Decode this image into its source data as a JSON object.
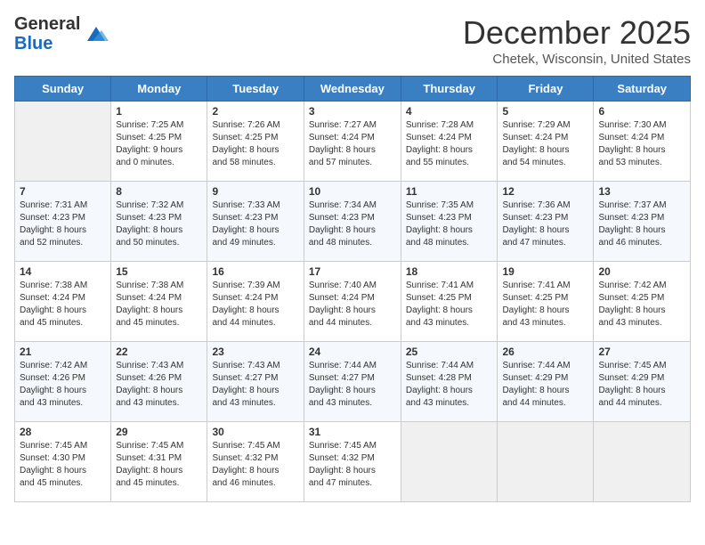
{
  "header": {
    "logo_general": "General",
    "logo_blue": "Blue",
    "month_title": "December 2025",
    "location": "Chetek, Wisconsin, United States"
  },
  "days_of_week": [
    "Sunday",
    "Monday",
    "Tuesday",
    "Wednesday",
    "Thursday",
    "Friday",
    "Saturday"
  ],
  "weeks": [
    [
      {
        "day": "",
        "sunrise": "",
        "sunset": "",
        "daylight": ""
      },
      {
        "day": "1",
        "sunrise": "Sunrise: 7:25 AM",
        "sunset": "Sunset: 4:25 PM",
        "daylight": "Daylight: 9 hours and 0 minutes."
      },
      {
        "day": "2",
        "sunrise": "Sunrise: 7:26 AM",
        "sunset": "Sunset: 4:25 PM",
        "daylight": "Daylight: 8 hours and 58 minutes."
      },
      {
        "day": "3",
        "sunrise": "Sunrise: 7:27 AM",
        "sunset": "Sunset: 4:24 PM",
        "daylight": "Daylight: 8 hours and 57 minutes."
      },
      {
        "day": "4",
        "sunrise": "Sunrise: 7:28 AM",
        "sunset": "Sunset: 4:24 PM",
        "daylight": "Daylight: 8 hours and 55 minutes."
      },
      {
        "day": "5",
        "sunrise": "Sunrise: 7:29 AM",
        "sunset": "Sunset: 4:24 PM",
        "daylight": "Daylight: 8 hours and 54 minutes."
      },
      {
        "day": "6",
        "sunrise": "Sunrise: 7:30 AM",
        "sunset": "Sunset: 4:24 PM",
        "daylight": "Daylight: 8 hours and 53 minutes."
      }
    ],
    [
      {
        "day": "7",
        "sunrise": "Sunrise: 7:31 AM",
        "sunset": "Sunset: 4:23 PM",
        "daylight": "Daylight: 8 hours and 52 minutes."
      },
      {
        "day": "8",
        "sunrise": "Sunrise: 7:32 AM",
        "sunset": "Sunset: 4:23 PM",
        "daylight": "Daylight: 8 hours and 50 minutes."
      },
      {
        "day": "9",
        "sunrise": "Sunrise: 7:33 AM",
        "sunset": "Sunset: 4:23 PM",
        "daylight": "Daylight: 8 hours and 49 minutes."
      },
      {
        "day": "10",
        "sunrise": "Sunrise: 7:34 AM",
        "sunset": "Sunset: 4:23 PM",
        "daylight": "Daylight: 8 hours and 48 minutes."
      },
      {
        "day": "11",
        "sunrise": "Sunrise: 7:35 AM",
        "sunset": "Sunset: 4:23 PM",
        "daylight": "Daylight: 8 hours and 48 minutes."
      },
      {
        "day": "12",
        "sunrise": "Sunrise: 7:36 AM",
        "sunset": "Sunset: 4:23 PM",
        "daylight": "Daylight: 8 hours and 47 minutes."
      },
      {
        "day": "13",
        "sunrise": "Sunrise: 7:37 AM",
        "sunset": "Sunset: 4:23 PM",
        "daylight": "Daylight: 8 hours and 46 minutes."
      }
    ],
    [
      {
        "day": "14",
        "sunrise": "Sunrise: 7:38 AM",
        "sunset": "Sunset: 4:24 PM",
        "daylight": "Daylight: 8 hours and 45 minutes."
      },
      {
        "day": "15",
        "sunrise": "Sunrise: 7:38 AM",
        "sunset": "Sunset: 4:24 PM",
        "daylight": "Daylight: 8 hours and 45 minutes."
      },
      {
        "day": "16",
        "sunrise": "Sunrise: 7:39 AM",
        "sunset": "Sunset: 4:24 PM",
        "daylight": "Daylight: 8 hours and 44 minutes."
      },
      {
        "day": "17",
        "sunrise": "Sunrise: 7:40 AM",
        "sunset": "Sunset: 4:24 PM",
        "daylight": "Daylight: 8 hours and 44 minutes."
      },
      {
        "day": "18",
        "sunrise": "Sunrise: 7:41 AM",
        "sunset": "Sunset: 4:25 PM",
        "daylight": "Daylight: 8 hours and 43 minutes."
      },
      {
        "day": "19",
        "sunrise": "Sunrise: 7:41 AM",
        "sunset": "Sunset: 4:25 PM",
        "daylight": "Daylight: 8 hours and 43 minutes."
      },
      {
        "day": "20",
        "sunrise": "Sunrise: 7:42 AM",
        "sunset": "Sunset: 4:25 PM",
        "daylight": "Daylight: 8 hours and 43 minutes."
      }
    ],
    [
      {
        "day": "21",
        "sunrise": "Sunrise: 7:42 AM",
        "sunset": "Sunset: 4:26 PM",
        "daylight": "Daylight: 8 hours and 43 minutes."
      },
      {
        "day": "22",
        "sunrise": "Sunrise: 7:43 AM",
        "sunset": "Sunset: 4:26 PM",
        "daylight": "Daylight: 8 hours and 43 minutes."
      },
      {
        "day": "23",
        "sunrise": "Sunrise: 7:43 AM",
        "sunset": "Sunset: 4:27 PM",
        "daylight": "Daylight: 8 hours and 43 minutes."
      },
      {
        "day": "24",
        "sunrise": "Sunrise: 7:44 AM",
        "sunset": "Sunset: 4:27 PM",
        "daylight": "Daylight: 8 hours and 43 minutes."
      },
      {
        "day": "25",
        "sunrise": "Sunrise: 7:44 AM",
        "sunset": "Sunset: 4:28 PM",
        "daylight": "Daylight: 8 hours and 43 minutes."
      },
      {
        "day": "26",
        "sunrise": "Sunrise: 7:44 AM",
        "sunset": "Sunset: 4:29 PM",
        "daylight": "Daylight: 8 hours and 44 minutes."
      },
      {
        "day": "27",
        "sunrise": "Sunrise: 7:45 AM",
        "sunset": "Sunset: 4:29 PM",
        "daylight": "Daylight: 8 hours and 44 minutes."
      }
    ],
    [
      {
        "day": "28",
        "sunrise": "Sunrise: 7:45 AM",
        "sunset": "Sunset: 4:30 PM",
        "daylight": "Daylight: 8 hours and 45 minutes."
      },
      {
        "day": "29",
        "sunrise": "Sunrise: 7:45 AM",
        "sunset": "Sunset: 4:31 PM",
        "daylight": "Daylight: 8 hours and 45 minutes."
      },
      {
        "day": "30",
        "sunrise": "Sunrise: 7:45 AM",
        "sunset": "Sunset: 4:32 PM",
        "daylight": "Daylight: 8 hours and 46 minutes."
      },
      {
        "day": "31",
        "sunrise": "Sunrise: 7:45 AM",
        "sunset": "Sunset: 4:32 PM",
        "daylight": "Daylight: 8 hours and 47 minutes."
      },
      {
        "day": "",
        "sunrise": "",
        "sunset": "",
        "daylight": ""
      },
      {
        "day": "",
        "sunrise": "",
        "sunset": "",
        "daylight": ""
      },
      {
        "day": "",
        "sunrise": "",
        "sunset": "",
        "daylight": ""
      }
    ]
  ]
}
